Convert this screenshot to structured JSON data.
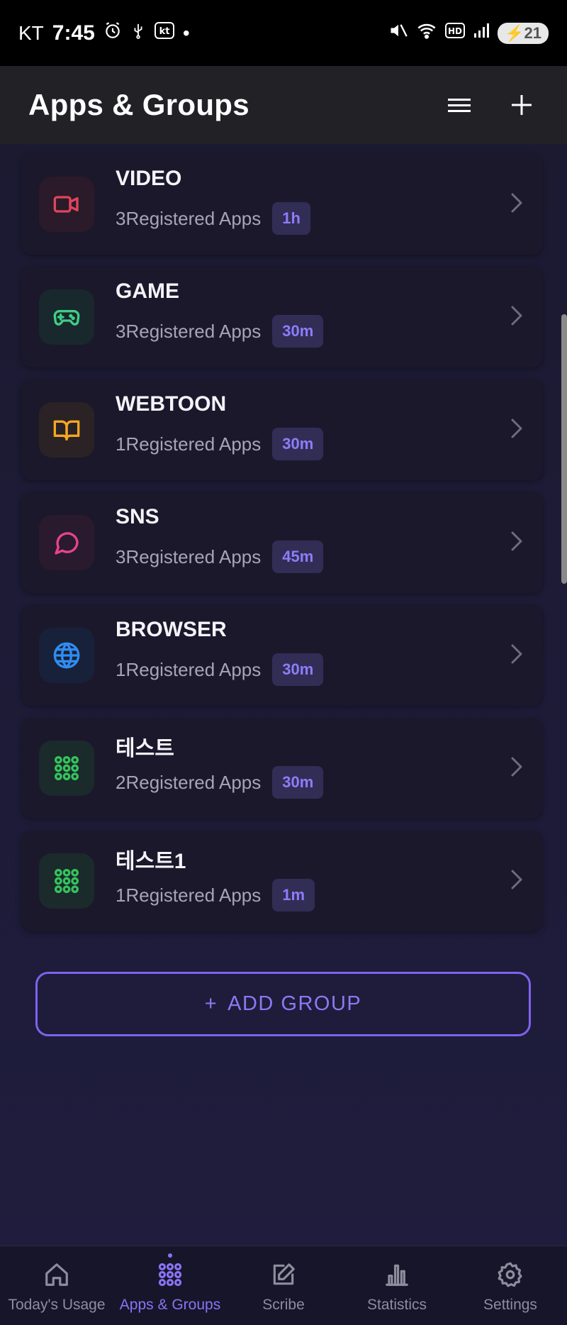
{
  "status_bar": {
    "carrier": "KT",
    "time": "7:45",
    "dot": "•",
    "battery": "21",
    "icons": [
      "alarm-icon",
      "usb-icon",
      "kt-icon",
      "mute-icon",
      "wifi-icon",
      "hd-icon",
      "signal-icon",
      "battery-icon"
    ]
  },
  "header": {
    "title": "Apps & Groups",
    "icons": [
      "menu-icon",
      "plus-icon"
    ]
  },
  "groups": [
    {
      "name": "VIDEO",
      "count": "3Registered Apps",
      "limit": "1h",
      "icon": "video-icon",
      "color": "#e0455a",
      "bg": "#2a1a2a"
    },
    {
      "name": "GAME",
      "count": "3Registered Apps",
      "limit": "30m",
      "icon": "gamepad-icon",
      "color": "#3fcf86",
      "bg": "#19282c"
    },
    {
      "name": "WEBTOON",
      "count": "1Registered Apps",
      "limit": "30m",
      "icon": "book-icon",
      "color": "#f5a623",
      "bg": "#2a2224"
    },
    {
      "name": "SNS",
      "count": "3Registered Apps",
      "limit": "45m",
      "icon": "chat-icon",
      "color": "#e8438c",
      "bg": "#2a1a2d"
    },
    {
      "name": "BROWSER",
      "count": "1Registered Apps",
      "limit": "30m",
      "icon": "globe-icon",
      "color": "#2f8df0",
      "bg": "#17213a"
    },
    {
      "name": "테스트",
      "count": "2Registered Apps",
      "limit": "30m",
      "icon": "grid-icon",
      "color": "#35c35d",
      "bg": "#1b2a2a"
    },
    {
      "name": "테스트1",
      "count": "1Registered Apps",
      "limit": "1m",
      "icon": "grid-icon",
      "color": "#35c35d",
      "bg": "#1b2a2a"
    }
  ],
  "add_group": {
    "icon": "+",
    "label": "ADD GROUP"
  },
  "bottom_nav": [
    {
      "label": "Today's Usage",
      "icon": "home-icon",
      "active": false
    },
    {
      "label": "Apps & Groups",
      "icon": "grid-icon",
      "active": true
    },
    {
      "label": "Scribe",
      "icon": "edit-icon",
      "active": false
    },
    {
      "label": "Statistics",
      "icon": "bar-chart-icon",
      "active": false
    },
    {
      "label": "Settings",
      "icon": "gear-icon",
      "active": false
    }
  ],
  "colors": {
    "accent": "#8a73f5",
    "background": "#1d1a35",
    "card": "#1b182c",
    "header": "#222126"
  }
}
